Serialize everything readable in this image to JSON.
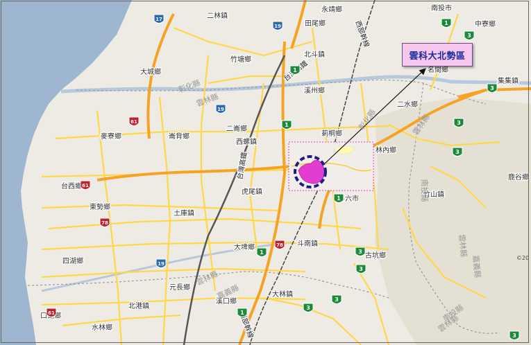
{
  "callout": {
    "label": "雲科大北勢區"
  },
  "copyright": "©20",
  "towns": [
    {
      "name": "二林鎮"
    },
    {
      "name": "永靖鄉"
    },
    {
      "name": "南投市"
    },
    {
      "name": "田尾鄉"
    },
    {
      "name": "中寮鄉"
    },
    {
      "name": "北斗鎮"
    },
    {
      "name": "大城鄉"
    },
    {
      "name": "竹塘鄉"
    },
    {
      "name": "名間鄉"
    },
    {
      "name": "溪州鄉"
    },
    {
      "name": "集集鎮"
    },
    {
      "name": "二水鄉"
    },
    {
      "name": "麥寮鄉"
    },
    {
      "name": "崙背鄉"
    },
    {
      "name": "二崙鄉"
    },
    {
      "name": "莿桐鄉"
    },
    {
      "name": "西螺鎮"
    },
    {
      "name": "林內鄉"
    },
    {
      "name": "鹿谷鄉"
    },
    {
      "name": "台西鄉"
    },
    {
      "name": "東勢鄉"
    },
    {
      "name": "虎尾鎮"
    },
    {
      "name": "斗六市"
    },
    {
      "name": "竹山鎮"
    },
    {
      "name": "土庫鎮"
    },
    {
      "name": "大埤鄉"
    },
    {
      "name": "斗南鎮"
    },
    {
      "name": "古坑鄉"
    },
    {
      "name": "四湖鄉"
    },
    {
      "name": "元長鄉"
    },
    {
      "name": "北港鎮"
    },
    {
      "name": "溪口鄉"
    },
    {
      "name": "大林鎮"
    },
    {
      "name": "口湖鄉"
    },
    {
      "name": "水林鄉"
    }
  ],
  "roads": [
    {
      "name": "台灣高鐵"
    },
    {
      "name": "台灣高鐵"
    },
    {
      "name": "西部幹線"
    },
    {
      "name": "西部幹線"
    }
  ],
  "county_labels": [
    {
      "name": "彰化縣"
    },
    {
      "name": "雲林縣"
    },
    {
      "name": "彰化縣"
    },
    {
      "name": "雲林縣"
    },
    {
      "name": "南投縣"
    },
    {
      "name": "雲林縣"
    },
    {
      "name": "嘉義縣"
    },
    {
      "name": "雲林縣"
    },
    {
      "name": "嘉義縣"
    },
    {
      "name": "南投縣"
    },
    {
      "name": "雲林縣"
    }
  ],
  "shields": [
    {
      "number": "17"
    },
    {
      "number": "19"
    },
    {
      "number": "1"
    },
    {
      "number": "19"
    },
    {
      "number": "1"
    },
    {
      "number": "61"
    },
    {
      "number": "61"
    },
    {
      "number": "78"
    },
    {
      "number": "78"
    },
    {
      "number": "19"
    },
    {
      "number": "1"
    },
    {
      "number": "1"
    },
    {
      "number": "3"
    },
    {
      "number": "3"
    },
    {
      "number": "3"
    },
    {
      "number": "3"
    },
    {
      "number": "3"
    },
    {
      "number": "3"
    },
    {
      "number": "1"
    },
    {
      "number": "3"
    },
    {
      "number": "3"
    },
    {
      "number": "3"
    },
    {
      "number": "61"
    },
    {
      "number": "1"
    },
    {
      "number": "17"
    },
    {
      "number": "19"
    },
    {
      "number": "1"
    },
    {
      "number": "3"
    },
    {
      "number": "1"
    }
  ],
  "colors": {
    "land": "#eeebe4",
    "sea": "#9fb6d0",
    "road_yellow": "#ffd84a",
    "highway_orange": "#f4a325",
    "hsr": "#555555",
    "campus_magenta": "#e23cd0",
    "callout_bg": "#f6c6ef",
    "callout_text": "#1a2a9a",
    "circle_navy": "#1d1d8a"
  }
}
